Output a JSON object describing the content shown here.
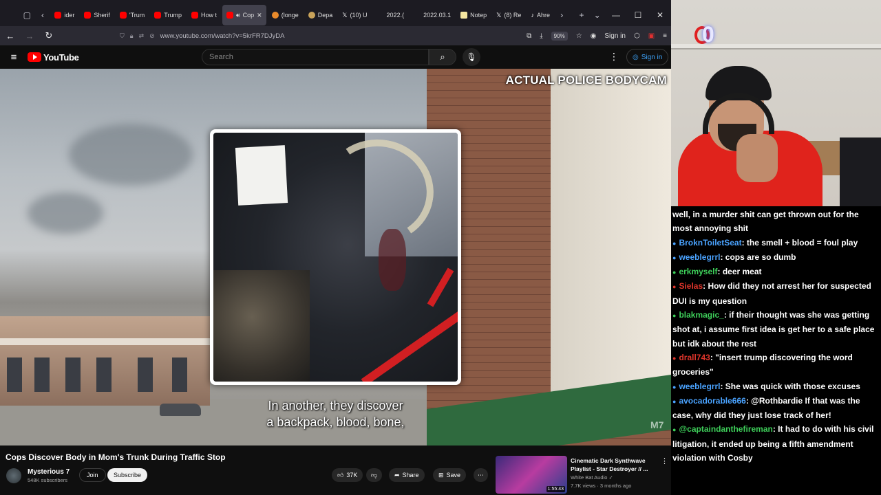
{
  "browser": {
    "tabs": [
      {
        "label": "ider",
        "icon": "yt"
      },
      {
        "label": "Sherif",
        "icon": "yt"
      },
      {
        "label": "'Trum",
        "icon": "yt"
      },
      {
        "label": "Trump",
        "icon": "yt"
      },
      {
        "label": "How t",
        "icon": "yt"
      },
      {
        "label": "Cop",
        "icon": "yt",
        "active": true
      },
      {
        "label": "(longe",
        "icon": "rnd"
      },
      {
        "label": "Depa",
        "icon": "g"
      },
      {
        "label": "(10) U",
        "icon": "x"
      },
      {
        "label": "2022.(",
        "icon": "none"
      },
      {
        "label": "2022.03.1",
        "icon": "none"
      },
      {
        "label": "Notep",
        "icon": "note"
      },
      {
        "label": "(8) Re",
        "icon": "x"
      },
      {
        "label": "Ahre",
        "icon": "tiktok"
      }
    ],
    "url": "www.youtube.com/watch?v=5krFR7DJyDA",
    "zoom": "90%",
    "signin_label": "Sign in"
  },
  "youtube": {
    "logo_text": "YouTube",
    "search_placeholder": "Search",
    "signin_label": "Sign in"
  },
  "video": {
    "overlay_label": "ACTUAL POLICE BODYCAM",
    "caption_line1": "In another, they discover",
    "caption_line2": "a backpack, blood, bone,",
    "watermark": "M7",
    "title": "Cops Discover Body in Mom's Trunk During Traffic Stop"
  },
  "channel": {
    "name": "Mysterious 7",
    "subscribers": "548K subscribers",
    "join_label": "Join",
    "subscribe_label": "Subscribe"
  },
  "actions": {
    "likes": "37K",
    "share_label": "Share",
    "save_label": "Save"
  },
  "recommended": {
    "title": "Cinematic Dark Synthwave Playlist - Star Destroyer // ...",
    "channel": "White Bat Audio",
    "meta": "7.7K views · 3 months ago",
    "duration": "1:55:43"
  },
  "stream": {
    "counter": "0",
    "chat": [
      {
        "user": "",
        "color": "#ffffff",
        "text": "well, in a murder shit can get thrown out for the most annoying shit"
      },
      {
        "user": "BroknToiletSeat",
        "color": "#4aa3ff",
        "text": ": the smell + blood = foul play"
      },
      {
        "user": "weeblegrrl",
        "color": "#4aa3ff",
        "text": ": cops are so dumb"
      },
      {
        "user": "erkmyself",
        "color": "#3ecf5a",
        "text": ": deer meat"
      },
      {
        "user": "Sielas",
        "color": "#e0352b",
        "text": ": How did they not arrest her for suspected DUI is my question"
      },
      {
        "user": "blakmagic_",
        "color": "#3ecf5a",
        "text": ": if their thought was she was getting shot at, i assume first idea is get her to a safe place but idk about the rest"
      },
      {
        "user": "drall743",
        "color": "#e0352b",
        "text": ": \"insert trump discovering the word groceries\""
      },
      {
        "user": "weeblegrrl",
        "color": "#4aa3ff",
        "text": ": She was quick with those excuses"
      },
      {
        "user": "avocadorable666",
        "color": "#4aa3ff",
        "text": ": @Rothbardie If that was the case, why did they just lose track of her!"
      },
      {
        "user": "@captaindanthefireman",
        "color": "#3ecf5a",
        "text": ": It had to do with his civil litigation, it ended up being a fifth amendment violation with Cosby"
      }
    ]
  }
}
